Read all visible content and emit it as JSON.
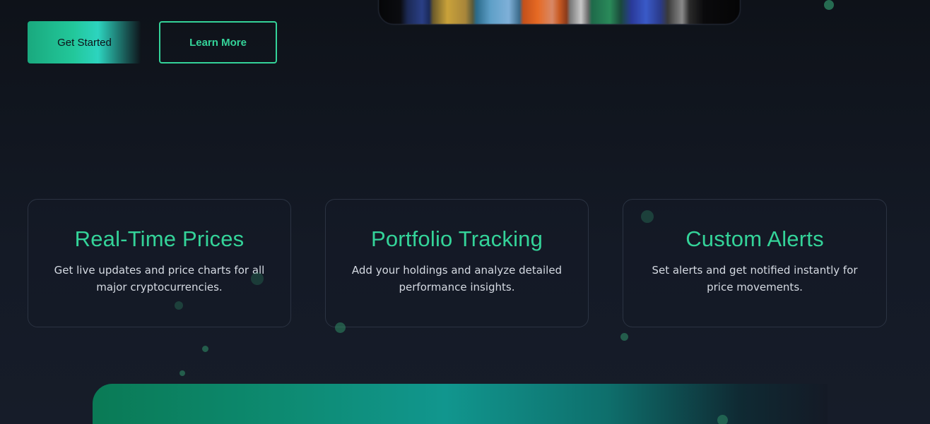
{
  "hero": {
    "primary_button": "Get Started",
    "secondary_button": "Learn More"
  },
  "features": [
    {
      "title": "Real-Time Prices",
      "description": "Get live updates and price charts for all major cryptocurrencies."
    },
    {
      "title": "Portfolio Tracking",
      "description": "Add your holdings and analyze detailed performance insights."
    },
    {
      "title": "Custom Alerts",
      "description": "Set alerts and get notified instantly for price movements."
    }
  ],
  "colors": {
    "accent": "#34d399",
    "background": "#0e1219"
  }
}
